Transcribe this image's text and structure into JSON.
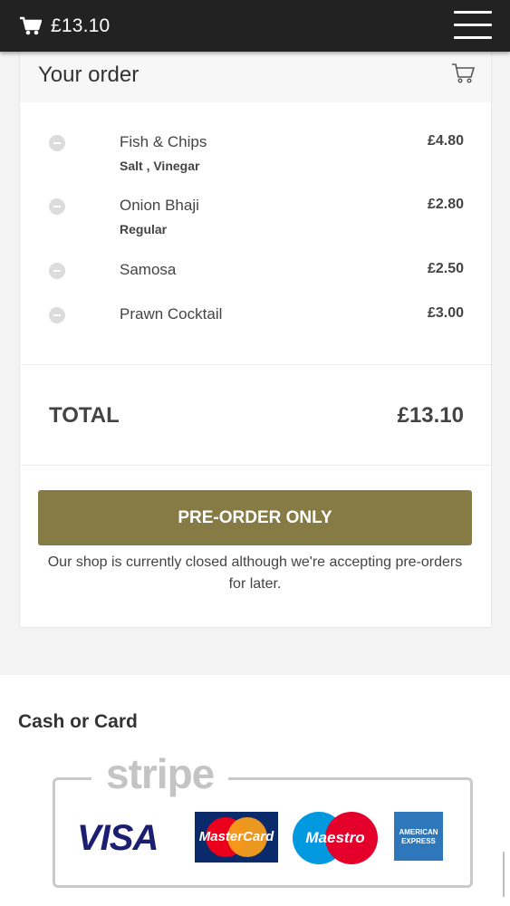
{
  "header": {
    "cart_total": "£13.10",
    "cart_icon": "cart-icon",
    "menu_icon": "hamburger-menu-icon"
  },
  "order": {
    "title": "Your order",
    "basket_icon": "shopping-cart-icon",
    "items": [
      {
        "name": "Fish & Chips",
        "options": "Salt , Vinegar",
        "price": "£4.80"
      },
      {
        "name": "Onion Bhaji",
        "options": "Regular",
        "price": "£2.80"
      },
      {
        "name": "Samosa",
        "options": "",
        "price": "£2.50"
      },
      {
        "name": "Prawn Cocktail",
        "options": "",
        "price": "£3.00"
      }
    ],
    "total_label": "TOTAL",
    "total_value": "£13.10",
    "button_label": "PRE-ORDER ONLY",
    "notice": "Our shop is currently closed although we're accepting pre-orders for later.",
    "button_color": "#877b45"
  },
  "payment": {
    "title": "Cash or Card",
    "provider": "stripe",
    "cards": {
      "visa": "VISA",
      "mastercard": "MasterCard",
      "maestro": "Maestro",
      "amex": "AMERICAN EXPRESS"
    }
  }
}
